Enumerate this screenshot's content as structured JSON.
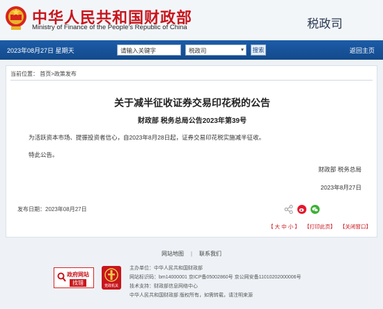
{
  "header": {
    "site_name_cn": "中华人民共和国财政部",
    "site_name_en": "Ministry of Finance of the People’s Republic of China",
    "section": "税政司"
  },
  "nav": {
    "date": "2023年08月27日  星期天",
    "search_placeholder": "请输入关键字",
    "scope": "税政司",
    "search_button": "搜索",
    "home_link": "返回主页"
  },
  "breadcrumb": "当前位置： 首页>政策发布",
  "article": {
    "title": "关于减半征收证券交易印花税的公告",
    "subtitle": "财政部  税务总局公告2023年第39号",
    "paragraph1": "为活跃资本市场、提振投资者信心，自2023年8月28日起，证券交易印花税实施减半征收。",
    "paragraph2": "特此公告。",
    "signature": "财政部    税务总局",
    "sign_date": "2023年8月27日",
    "publish_date": "发布日期：2023年08月27日",
    "font_size_label": "【 大  中  小 】",
    "print_label": "【打印此页】",
    "close_label": "【关闭窗口】"
  },
  "share_icons": [
    "share-icon",
    "weibo-icon",
    "wechat-icon"
  ],
  "footer": {
    "sitemap": "网站地图",
    "contact": "联系我们",
    "host": "主办单位：中华人民共和国财政部",
    "site_id": "网站标识码：bm14000001   京ICP备05002860号   京公网安备11010202000006号",
    "support": "技术支持：财政部信息网络中心",
    "copyright": "中华人民共和国财政部 版权所有，如需转载，请注明来源",
    "badge_top": "政府网站",
    "badge_bottom": "找错",
    "badge2_text": "党政机关"
  },
  "colors": {
    "brand_red": "#c8161d",
    "nav_blue": "#1a57a0"
  }
}
